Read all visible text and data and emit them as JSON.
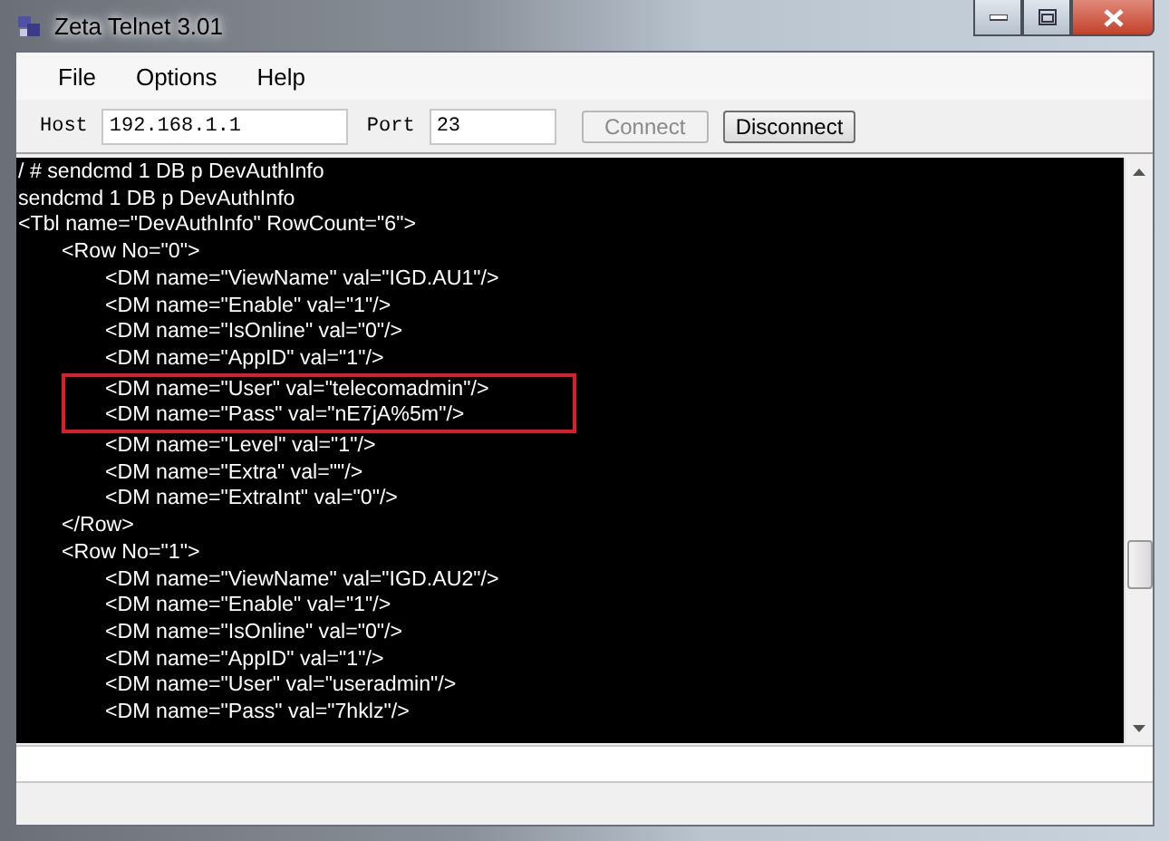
{
  "window": {
    "title": "Zeta Telnet 3.01"
  },
  "menu": [
    "File",
    "Options",
    "Help"
  ],
  "toolbar": {
    "host_label": "Host",
    "host": "192.168.1.1",
    "port_label": "Port",
    "port": "23",
    "connect": {
      "label": "Connect",
      "disabled": true
    },
    "disconnect": {
      "label": "Disconnect",
      "disabled": false
    }
  },
  "terminal": {
    "lines": [
      {
        "text": "/ # sendcmd 1 DB p DevAuthInfo"
      },
      {
        "text": "sendcmd 1 DB p DevAuthInfo"
      },
      {
        "text": "<Tbl name=\"DevAuthInfo\" RowCount=\"6\">",
        "children": [
          {
            "text": "<Row No=\"0\">",
            "children": [
              {
                "text": "<DM name=\"ViewName\" val=\"IGD.AU1\"/>"
              },
              {
                "text": "<DM name=\"Enable\" val=\"1\"/>"
              },
              {
                "text": "<DM name=\"IsOnline\" val=\"0\"/>"
              },
              {
                "text": "<DM name=\"AppID\" val=\"1\"/>"
              },
              {
                "kind": "highlight",
                "children": [
                  {
                    "text": "<DM name=\"User\" val=\"telecomadmin\"/>"
                  },
                  {
                    "text": "<DM name=\"Pass\" val=\"nE7jA%5m\"/>"
                  }
                ]
              },
              {
                "text": "<DM name=\"Level\" val=\"1\"/>"
              },
              {
                "text": "<DM name=\"Extra\" val=\"\"/>"
              },
              {
                "text": "<DM name=\"ExtraInt\" val=\"0\"/>"
              }
            ]
          },
          {
            "text": "</Row>"
          },
          {
            "text": "<Row No=\"1\">",
            "children": [
              {
                "text": "<DM name=\"ViewName\" val=\"IGD.AU2\"/>"
              },
              {
                "text": "<DM name=\"Enable\" val=\"1\"/>"
              },
              {
                "text": "<DM name=\"IsOnline\" val=\"0\"/>"
              },
              {
                "text": "<DM name=\"AppID\" val=\"1\"/>"
              },
              {
                "text": "<DM name=\"User\" val=\"useradmin\"/>"
              },
              {
                "text": "<DM name=\"Pass\" val=\"7hklz\"/>"
              }
            ]
          }
        ]
      }
    ]
  }
}
